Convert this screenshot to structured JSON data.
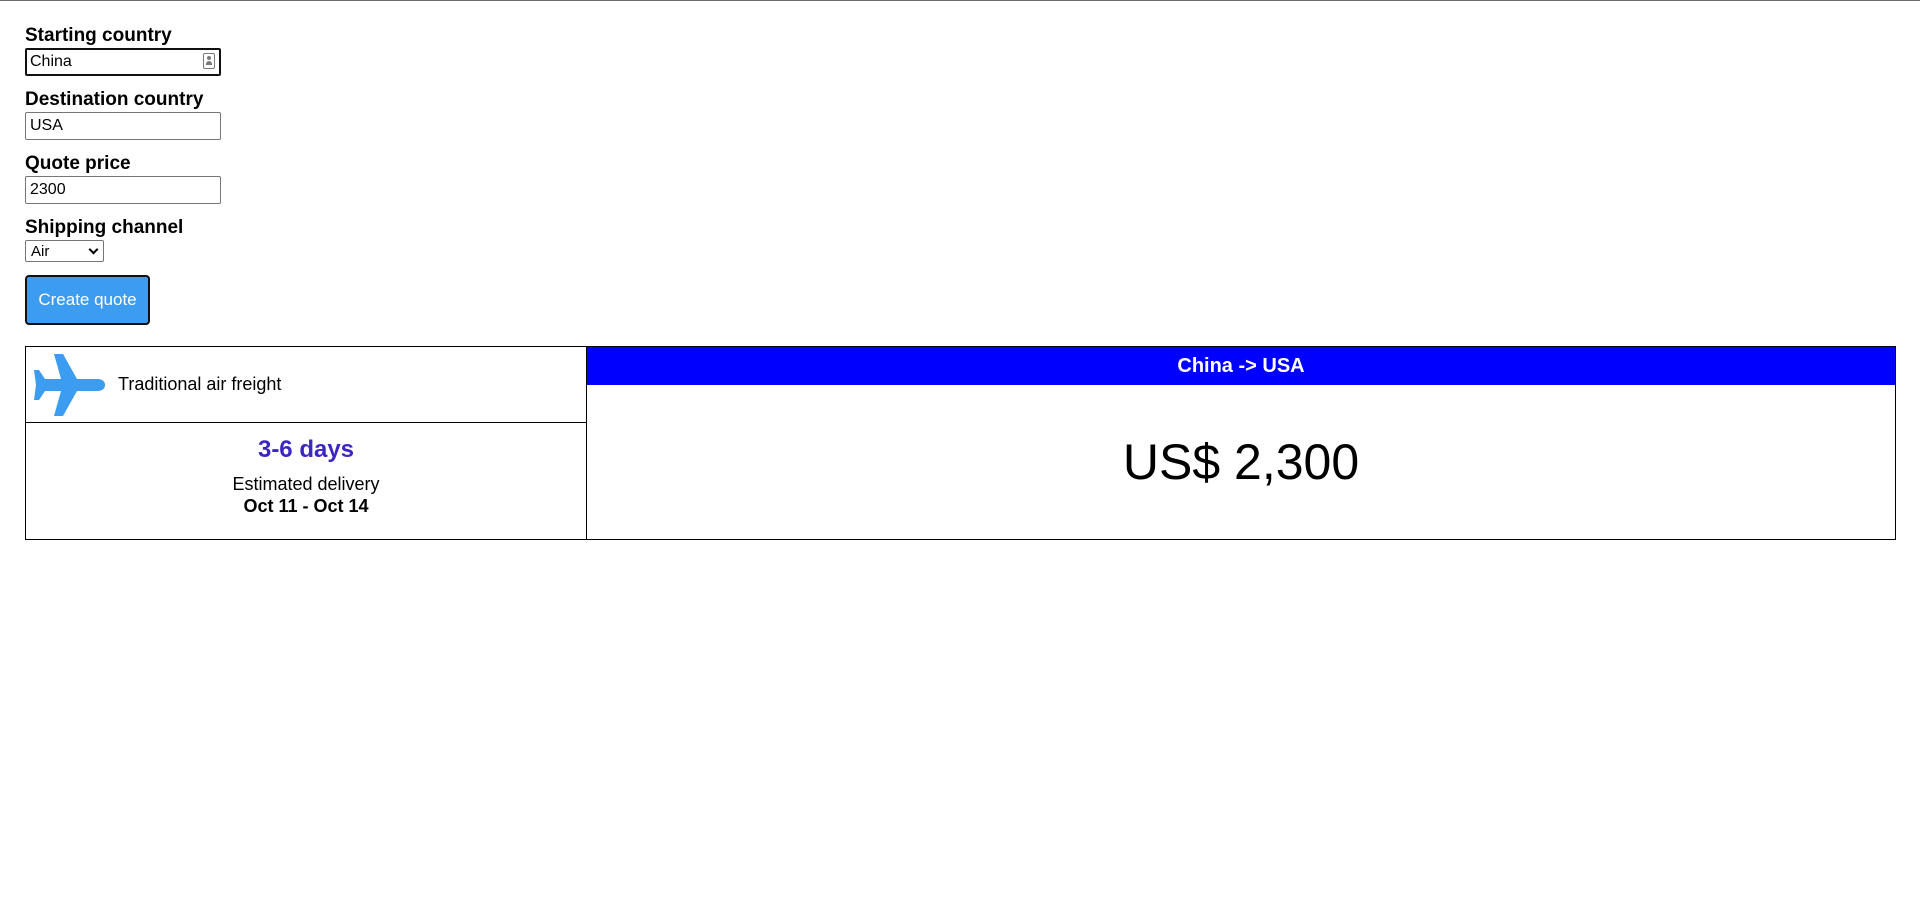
{
  "form": {
    "starting_country": {
      "label": "Starting country",
      "value": "China"
    },
    "destination_country": {
      "label": "Destination country",
      "value": "USA"
    },
    "quote_price": {
      "label": "Quote price",
      "value": "2300"
    },
    "shipping_channel": {
      "label": "Shipping channel",
      "selected": "Air"
    },
    "create_button_label": "Create quote"
  },
  "quote": {
    "channel_icon": "airplane-icon",
    "channel_name": "Traditional air freight",
    "transit_time": "3-6 days",
    "estimated_label": "Estimated delivery",
    "delivery_range": "Oct 11 - Oct 14",
    "route": "China -> USA",
    "price": "US$ 2,300"
  },
  "colors": {
    "button_bg": "#3b9cf0",
    "icon": "#3b9cf0",
    "route_header_bg": "#0000ff",
    "transit_time_text": "#3a27c2"
  }
}
